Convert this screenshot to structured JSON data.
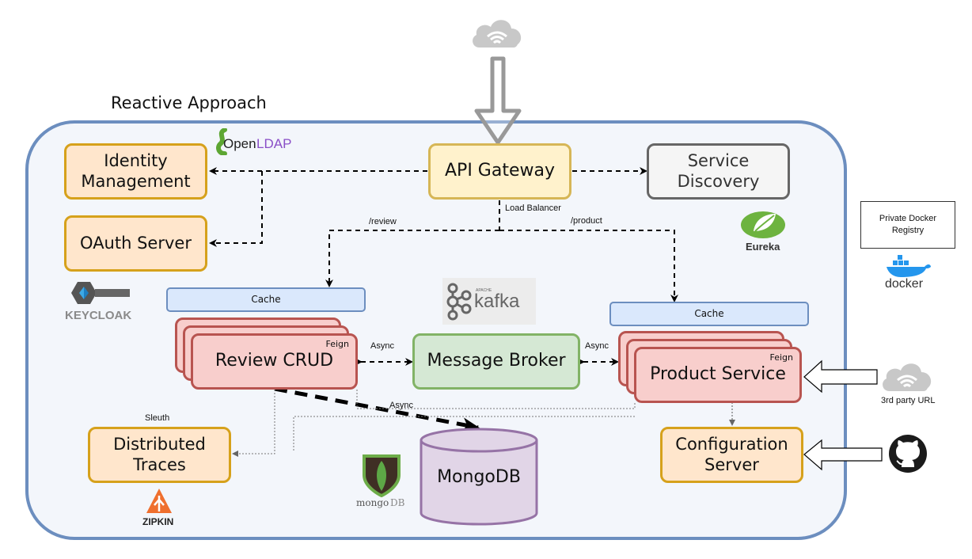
{
  "title": "Reactive Approach",
  "nodes": {
    "identity": "Identity\nManagement",
    "oauth": "OAuth Server",
    "gateway": "API Gateway",
    "discovery": "Service\nDiscovery",
    "review_cache": "Cache",
    "review": "Review CRUD",
    "review_tag": "Feign",
    "broker": "Message Broker",
    "product_cache": "Cache",
    "product": "Product Service",
    "product_tag": "Feign",
    "traces": "Distributed\nTraces",
    "mongodb": "MongoDB",
    "config": "Configuration\nServer",
    "registry": "Private Docker\nRegistry"
  },
  "edge_labels": {
    "load_balancer": "Load Balancer",
    "review_route": "/review",
    "product_route": "/product",
    "async_review": "Async",
    "async_product": "Async",
    "async_db": "Async",
    "sleuth": "Sleuth",
    "third_party": "3rd party URL"
  },
  "logos": {
    "openldap_a": "Open",
    "openldap_b": "LDAP",
    "keycloak": "KEYCLOAK",
    "kafka_small": "APACHE",
    "kafka": "kafka",
    "eureka": "Eureka",
    "docker": "docker",
    "zipkin": "ZIPKIN",
    "mongo_a": "mongo",
    "mongo_b": "DB"
  },
  "colors": {
    "container_border": "#6c8ebf",
    "orange_fill": "#ffe6cc",
    "orange_border": "#d6a11b",
    "red_fill": "#f8cecc",
    "red_border": "#b85450",
    "green_fill": "#d5e8d4",
    "green_border": "#82b366",
    "purple_fill": "#e1d5e7",
    "purple_border": "#9673a6"
  }
}
